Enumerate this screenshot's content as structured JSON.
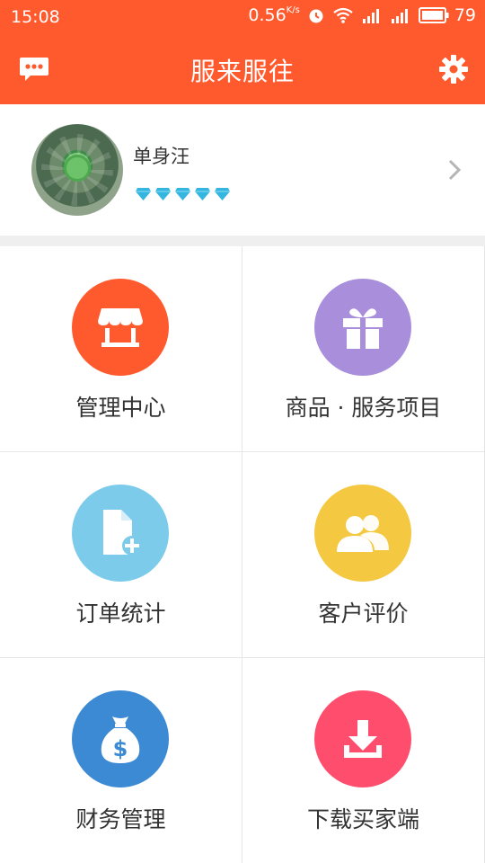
{
  "status_bar": {
    "time": "15:08",
    "net_speed": "0.56",
    "net_speed_unit": "K/s",
    "battery": "79"
  },
  "app_bar": {
    "title": "服来服往",
    "left_icon": "chat-bubble-icon",
    "right_icon": "gear-icon"
  },
  "profile": {
    "name": "单身汪",
    "level_icon": "diamond-icon",
    "level_count": 5
  },
  "menu": [
    {
      "label": "管理中心",
      "icon": "store-icon",
      "color": "#ff5a2e"
    },
    {
      "label": "商品 · 服务项目",
      "icon": "gift-icon",
      "color": "#a98fdb"
    },
    {
      "label": "订单统计",
      "icon": "document-add-icon",
      "color": "#7ccbeb"
    },
    {
      "label": "客户评价",
      "icon": "users-icon",
      "color": "#f5c842"
    },
    {
      "label": "财务管理",
      "icon": "money-bag-icon",
      "color": "#3d8ad4"
    },
    {
      "label": "下载买家端",
      "icon": "download-icon",
      "color": "#ff4d6d"
    }
  ],
  "colors": {
    "primary": "#ff5a2e",
    "background_band": "#efefef",
    "diamond": "#35b6e0"
  }
}
